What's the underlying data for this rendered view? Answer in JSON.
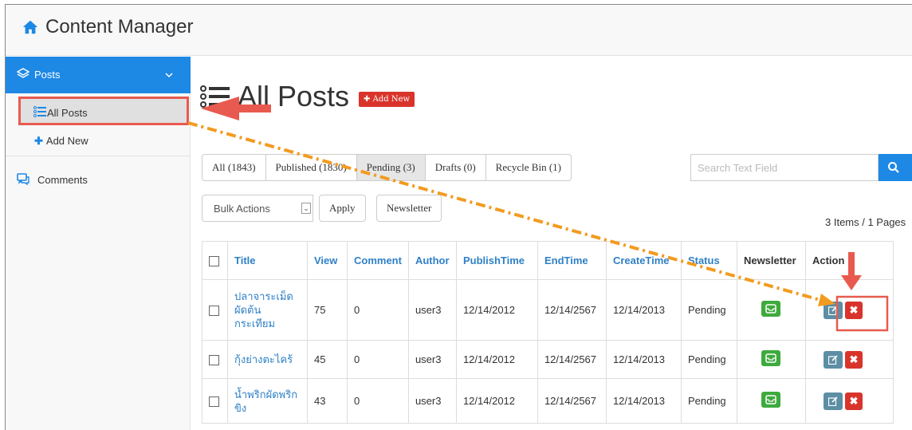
{
  "app": {
    "title": "Content Manager"
  },
  "sidebar": {
    "posts_label": "Posts",
    "all_posts_label": "All Posts",
    "add_new_label": "Add New",
    "comments_label": "Comments"
  },
  "header": {
    "title": "All Posts",
    "add_new_button": "Add New"
  },
  "tabs": [
    {
      "label": "All (1843)"
    },
    {
      "label": "Published (1830)"
    },
    {
      "label": "Pending (3)"
    },
    {
      "label": "Drafts (0)"
    },
    {
      "label": "Recycle Bin (1)"
    }
  ],
  "search": {
    "placeholder": "Search Text Field"
  },
  "toolbar": {
    "bulk_actions": "Bulk Actions",
    "apply": "Apply",
    "newsletter": "Newsletter",
    "count": "3 Items / 1 Pages"
  },
  "table": {
    "headers": [
      "Title",
      "View",
      "Comment",
      "Author",
      "PublishTime",
      "EndTime",
      "CreateTime",
      "Status",
      "Newsletter",
      "Action"
    ],
    "rows": [
      {
        "title": "ปลาจาระเม็ดผัดต้นกระเทียม",
        "view": "75",
        "comment": "0",
        "author": "user3",
        "publish": "12/14/2012",
        "end": "12/14/2567",
        "create": "12/14/2013",
        "status": "Pending"
      },
      {
        "title": "กุ้งย่างตะไคร้",
        "view": "45",
        "comment": "0",
        "author": "user3",
        "publish": "12/14/2012",
        "end": "12/14/2567",
        "create": "12/14/2013",
        "status": "Pending"
      },
      {
        "title": "น้ำพริกผัดพริกขิง",
        "view": "43",
        "comment": "0",
        "author": "user3",
        "publish": "12/14/2012",
        "end": "12/14/2567",
        "create": "12/14/2013",
        "status": "Pending"
      }
    ]
  },
  "colors": {
    "primary": "#1e88e5",
    "danger": "#d9342b",
    "success": "#3eaa3e",
    "edit": "#5c8ea4",
    "annotation_red": "#e85a4f",
    "annotation_orange": "#f29b1f"
  }
}
